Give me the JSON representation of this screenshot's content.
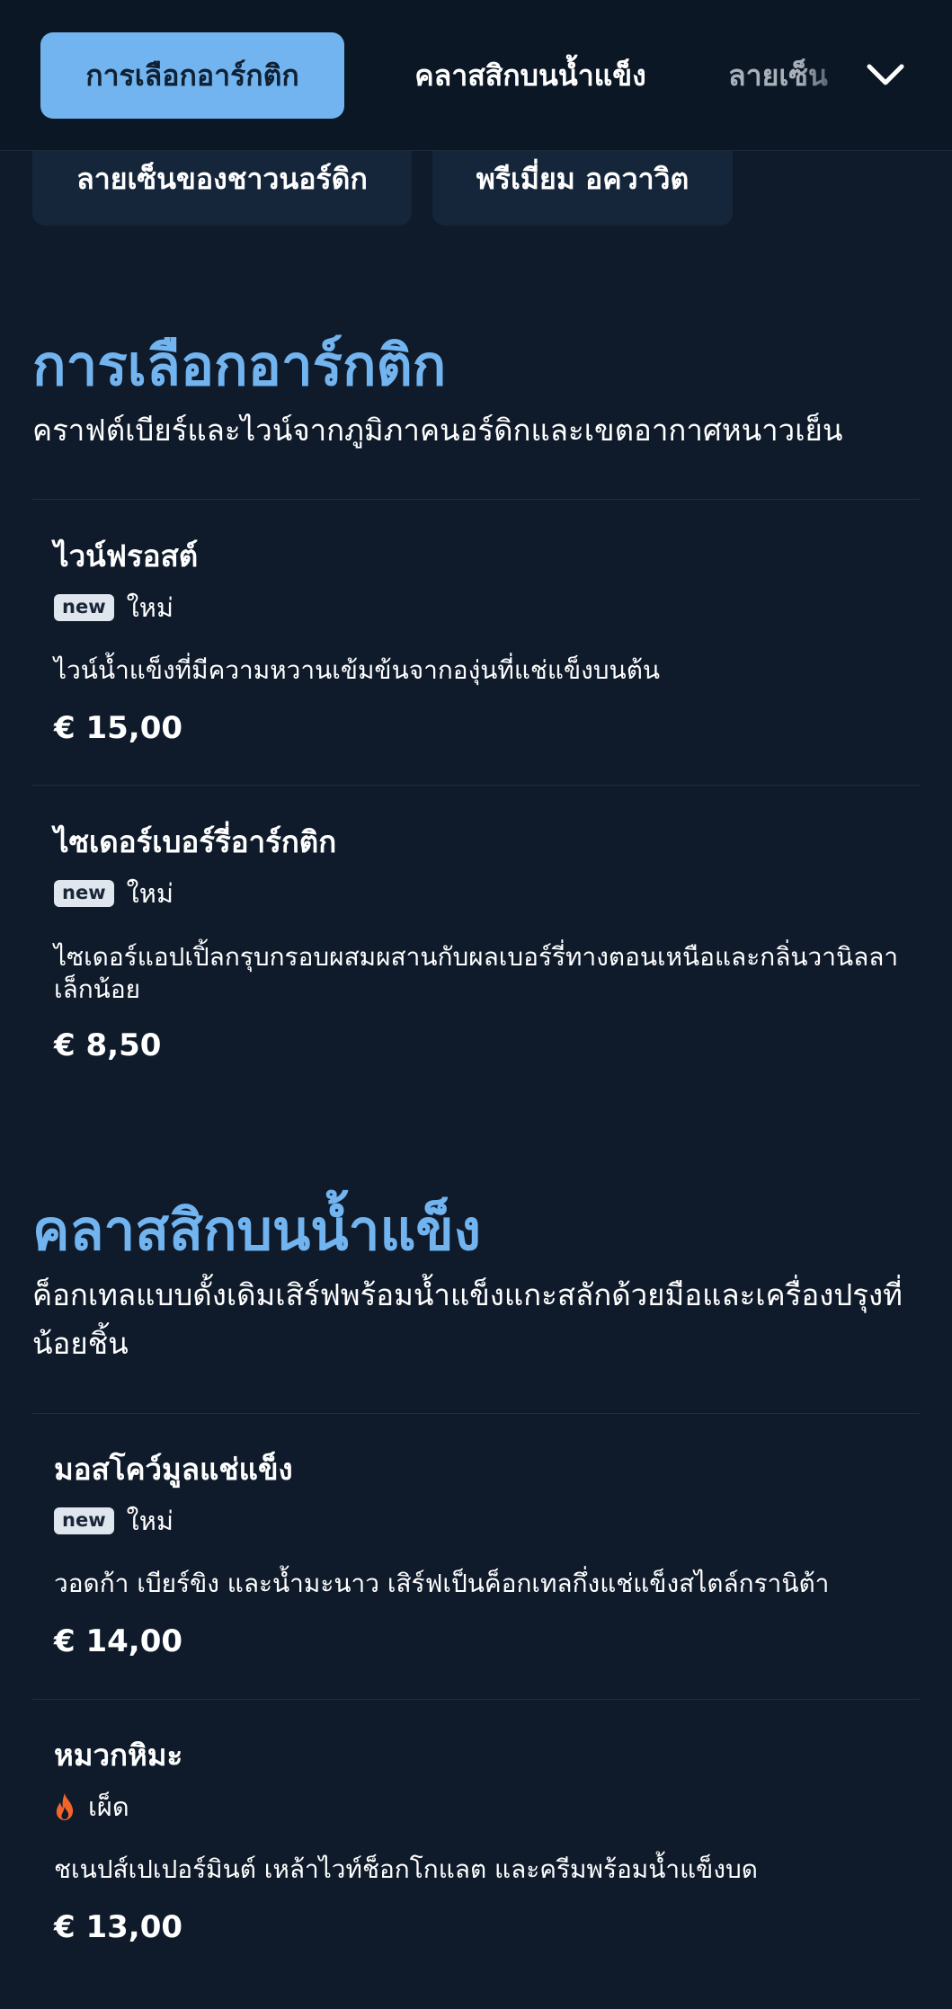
{
  "nav": {
    "tabs": [
      {
        "label": "การเลือกอาร์กติก",
        "active": true
      },
      {
        "label": "คลาสสิกบนน้ำแข็ง",
        "active": false
      },
      {
        "label": "ลายเซ็น",
        "active": false
      }
    ],
    "chips": [
      {
        "label": "ลายเซ็นของชาวนอร์ดิก"
      },
      {
        "label": "พรีเมี่ยม อควาวิต"
      }
    ],
    "expand_icon": "chevron-down-icon"
  },
  "sections": [
    {
      "title": "การเลือกอาร์กติก",
      "description": "คราฟต์เบียร์และไวน์จากภูมิภาคนอร์ดิกและเขตอากาศหนาวเย็น",
      "items": [
        {
          "name": "ไวน์ฟรอสต์",
          "badge": "new",
          "tag": "ใหม่",
          "description": "ไวน์น้ำแข็งที่มีความหวานเข้มข้นจากองุ่นที่แช่แข็งบนต้น",
          "price": "€ 15,00"
        },
        {
          "name": "ไซเดอร์เบอร์รี่อาร์กติก",
          "badge": "new",
          "tag": "ใหม่",
          "description": "ไซเดอร์แอปเปิ้ลกรุบกรอบผสมผสานกับผลเบอร์รี่ทางตอนเหนือและกลิ่นวานิลลาเล็กน้อย",
          "price": "€ 8,50"
        }
      ]
    },
    {
      "title": "คลาสสิกบนน้ำแข็ง",
      "description": "ค็อกเทลแบบดั้งเดิมเสิร์ฟพร้อมน้ำแข็งแกะสลักด้วยมือและเครื่องปรุงที่น้อยชิ้น",
      "items": [
        {
          "name": "มอสโคว์มูลแช่แข็ง",
          "badge": "new",
          "tag": "ใหม่",
          "description": "วอดก้า เบียร์ขิง และน้ำมะนาว เสิร์ฟเป็นค็อกเทลกึ่งแช่แข็งสไตล์กรานิต้า",
          "price": "€ 14,00"
        },
        {
          "name": "หมวกหิมะ",
          "badge_icon": "flame-icon",
          "tag": "เผ็ด",
          "description": "ชเนปส์เปเปอร์มินต์ เหล้าไวท์ช็อกโกแลต และครีมพร้อมน้ำแข็งบด",
          "price": "€ 13,00"
        }
      ]
    }
  ],
  "colors": {
    "background": "#0f1b2b",
    "nav_background": "#0c1725",
    "accent": "#72b4ef",
    "chip_background": "#15253a",
    "spicy": "#f2652a"
  }
}
